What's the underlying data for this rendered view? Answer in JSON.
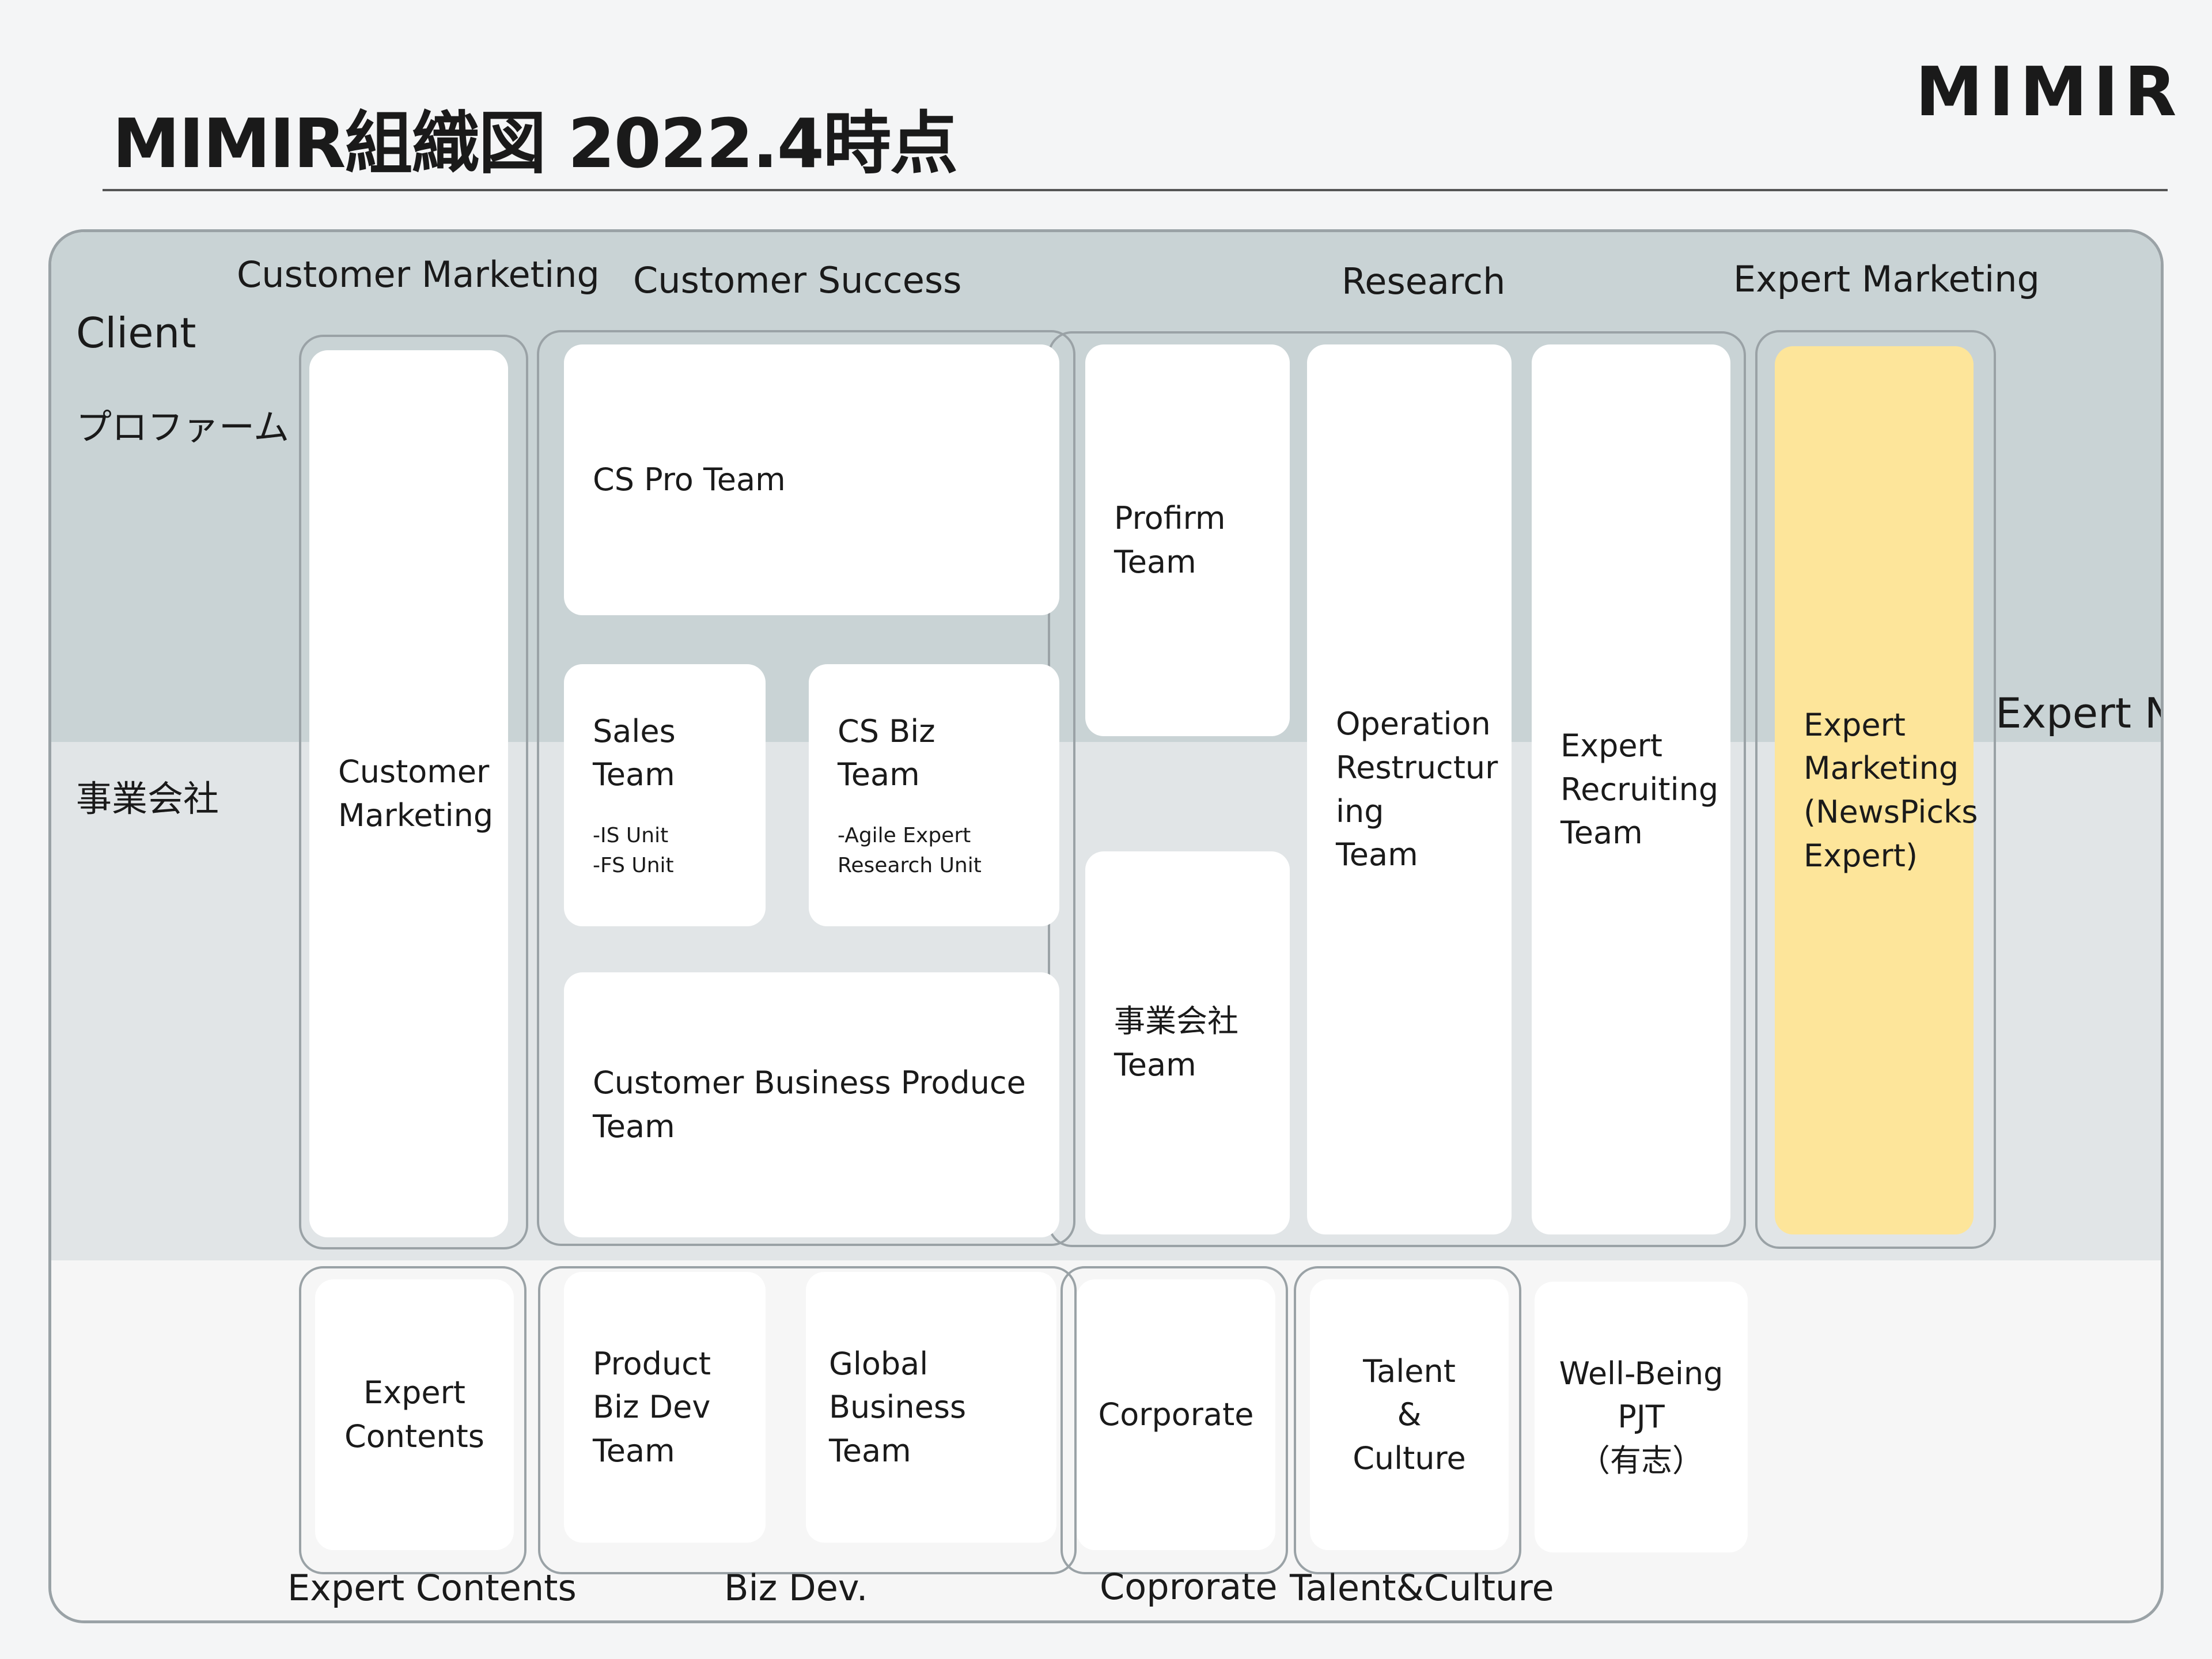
{
  "header": {
    "title": "MIMIR組織図 2022.4時点",
    "brand": "MIMIR"
  },
  "side_labels": {
    "client": "Client",
    "profirm": "プロファーム",
    "jigyo": "事業会社",
    "expert_network": "Expert\nNetwork"
  },
  "section_labels": {
    "customer_marketing": "Customer Marketing",
    "customer_success": "Customer Success",
    "research": "Research",
    "expert_marketing": "Expert Marketing",
    "expert_contents": "Expert Contents",
    "biz_dev": "Biz Dev.",
    "corporate": "Coprorate",
    "talent_culture": "Talent&Culture"
  },
  "teams": {
    "customer_marketing": "Customer\nMarketing",
    "cs_pro": "CS Pro Team",
    "sales": {
      "name": "Sales\nTeam",
      "units": "-IS Unit\n-FS Unit"
    },
    "cs_biz": {
      "name": "CS Biz\nTeam",
      "units": "-Agile Expert\nResearch Unit"
    },
    "cbp": "Customer Business Produce\nTeam",
    "profirm": "Profirm\nTeam",
    "jigyo": "事業会社\nTeam",
    "operation": "Operation\nRestructur\ning\nTeam",
    "expert_recruiting": "Expert\nRecruiting\nTeam",
    "expert_marketing": "Expert\nMarketing\n(NewsPicks\nExpert)",
    "expert_contents": "Expert\nContents",
    "product_biz_dev": "Product\nBiz Dev\nTeam",
    "global_business": "Global\nBusiness\nTeam",
    "corporate": "Corporate",
    "talent": "Talent\n&\nCulture",
    "well_being": "Well-Being\nPJT\n（有志）"
  },
  "colors": {
    "band_profirm": "#c9d3d5",
    "band_jigyo": "#e1e5e7",
    "highlight": "#fde59a"
  }
}
